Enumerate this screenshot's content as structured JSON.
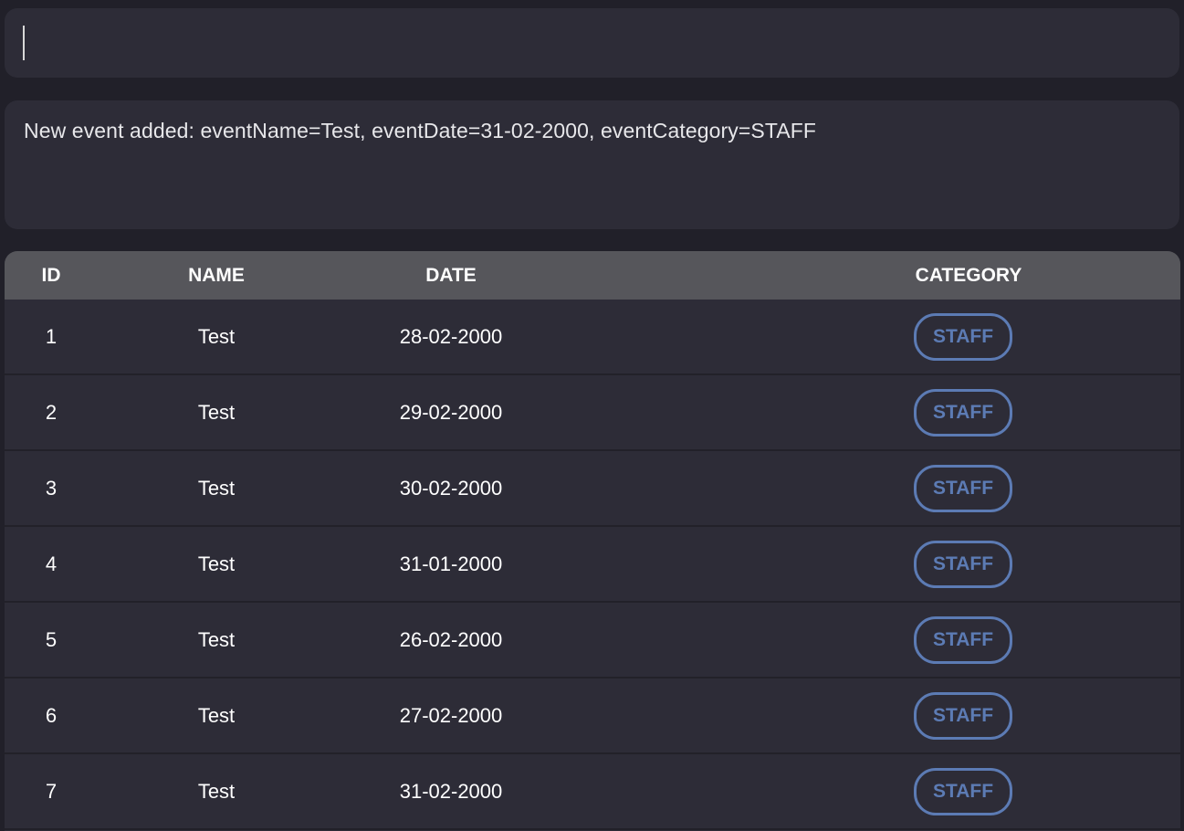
{
  "command": {
    "value": ""
  },
  "result": {
    "message": "New event added: eventName=Test, eventDate=31-02-2000, eventCategory=STAFF"
  },
  "table": {
    "headers": {
      "id": "ID",
      "name": "NAME",
      "date": "DATE",
      "category": "CATEGORY"
    },
    "rows": [
      {
        "id": "1",
        "name": "Test",
        "date": "28-02-2000",
        "category": "STAFF"
      },
      {
        "id": "2",
        "name": "Test",
        "date": "29-02-2000",
        "category": "STAFF"
      },
      {
        "id": "3",
        "name": "Test",
        "date": "30-02-2000",
        "category": "STAFF"
      },
      {
        "id": "4",
        "name": "Test",
        "date": "31-01-2000",
        "category": "STAFF"
      },
      {
        "id": "5",
        "name": "Test",
        "date": "26-02-2000",
        "category": "STAFF"
      },
      {
        "id": "6",
        "name": "Test",
        "date": "27-02-2000",
        "category": "STAFF"
      },
      {
        "id": "7",
        "name": "Test",
        "date": "31-02-2000",
        "category": "STAFF"
      }
    ]
  },
  "colors": {
    "background": "#212029",
    "panel": "#2d2c37",
    "header": "#56565b",
    "badge": "#5c7bb4"
  }
}
